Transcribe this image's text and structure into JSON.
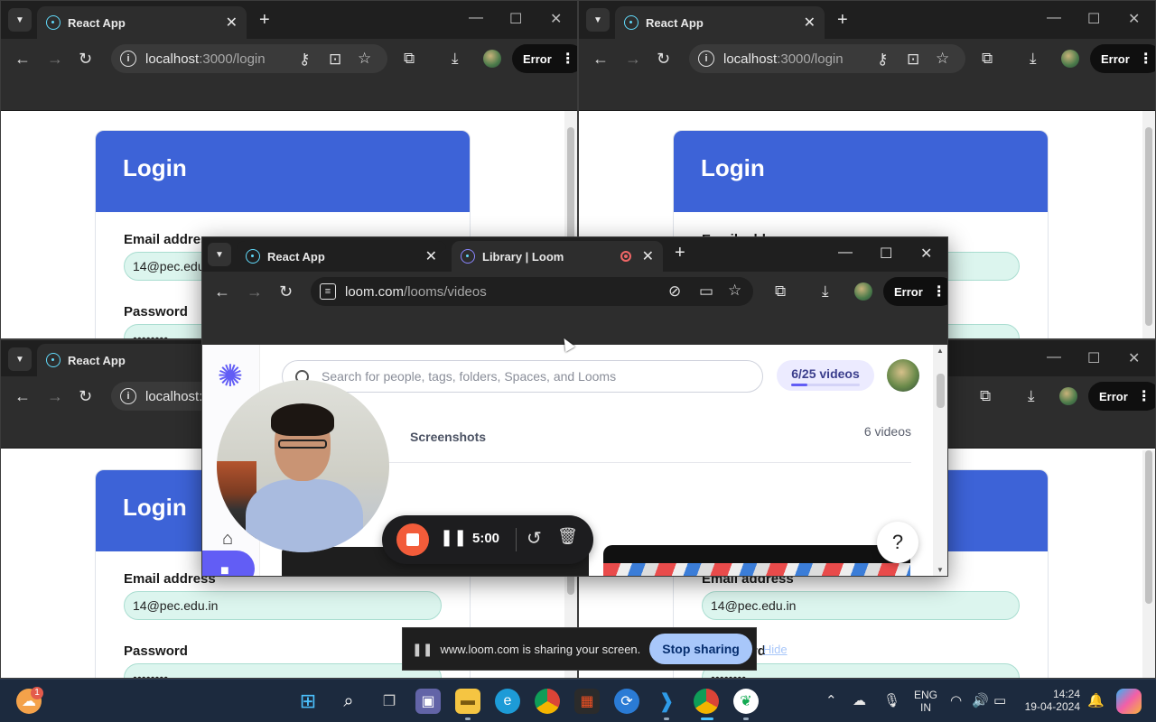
{
  "app_tab_title": "React App",
  "error_label": "Error",
  "login_page": {
    "title": "Login",
    "email_label": "Email address",
    "password_label": "Password",
    "email_value": "14@pec.edu.in",
    "email_value_cut": "14@pec.edu.",
    "password_value": "••••••••"
  },
  "windows": {
    "top_left": {
      "url_host": "localhost",
      "url_rest": ":3000/login"
    },
    "top_right": {
      "url_host": "localhost",
      "url_rest": ":3000/login"
    },
    "bottom_left": {
      "url_host": "localhost:3",
      "url_rest": ""
    }
  },
  "loom": {
    "tab1": "React App",
    "tab2": "Library | Loom",
    "url_host": "loom.com",
    "url_rest": "/looms/videos",
    "search_placeholder": "Search for people, tags, folders, Spaces, and Looms",
    "video_count": "6/25 videos",
    "video_progress": 0.24,
    "tab_me_partial": "e",
    "tab_screenshots": "Screenshots",
    "videos_label": "6 videos",
    "help": "?"
  },
  "recorder": {
    "time": "5:00"
  },
  "sharing": {
    "message": "www.loom.com is sharing your screen.",
    "stop": "Stop sharing",
    "hide": "Hide"
  },
  "taskbar": {
    "notification_badge": "1",
    "lang_line1": "ENG",
    "lang_line2": "IN",
    "time": "14:24",
    "date": "19-04-2024",
    "icons": [
      "weather-icon",
      "start-icon",
      "search-icon",
      "task-view-icon",
      "teams-icon",
      "file-explorer-icon",
      "edge-icon",
      "chrome-icon",
      "store-icon",
      "sync-icon",
      "vscode-icon",
      "chrome-active-icon",
      "mongodb-icon"
    ]
  },
  "colors": {
    "login_header": "#3d63d7",
    "input_fill": "#dcf5ee",
    "loom_accent": "#625df5",
    "stop_sharing": "#a8c7fa",
    "record_stop": "#f25c3a"
  }
}
